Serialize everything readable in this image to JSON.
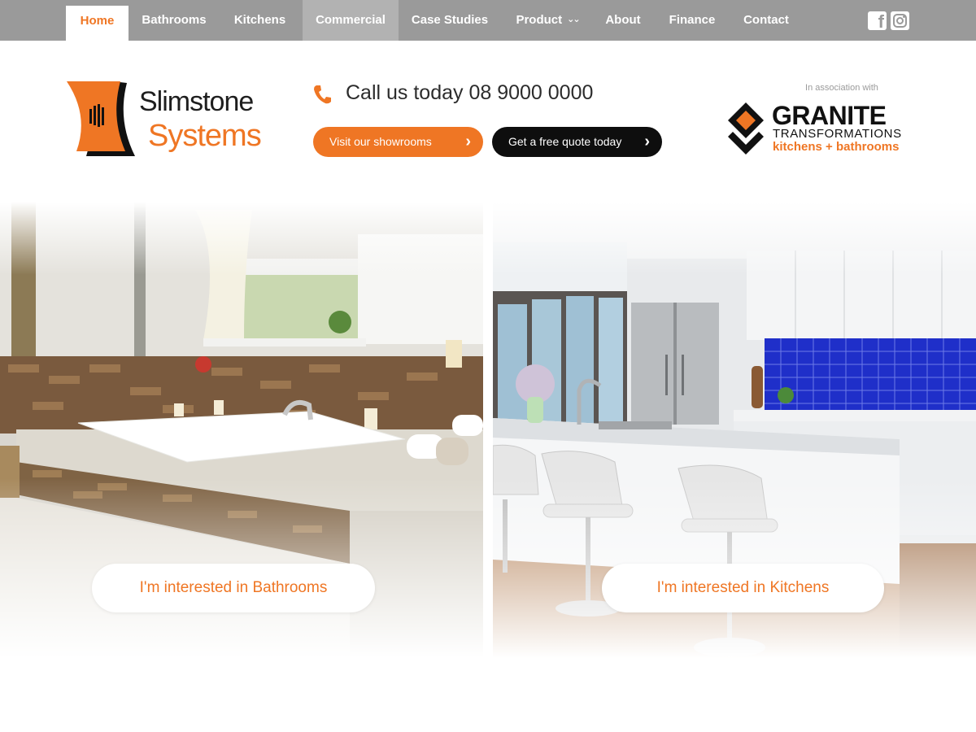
{
  "nav": {
    "items": [
      {
        "label": "Home",
        "active": true
      },
      {
        "label": "Bathrooms"
      },
      {
        "label": "Kitchens"
      },
      {
        "label": "Commercial",
        "highlighted": true
      },
      {
        "label": "Case Studies"
      },
      {
        "label": "Product",
        "has_dropdown": true
      },
      {
        "label": "About"
      },
      {
        "label": "Finance"
      },
      {
        "label": "Contact"
      }
    ],
    "social": [
      "facebook-icon",
      "instagram-icon"
    ]
  },
  "header": {
    "logo": {
      "line1": "Slimstone",
      "line2": "Systems"
    },
    "phone_text": "Call us today 08 9000 0000",
    "buttons": {
      "showrooms": "Visit our showrooms",
      "quote": "Get a free quote today"
    },
    "association": {
      "caption": "In association with",
      "brand": "GRANITE",
      "sub": "TRANSFORMATIONS",
      "tagline": "kitchens + bathrooms"
    }
  },
  "hero": {
    "bathrooms_cta": "I'm interested in Bathrooms",
    "kitchens_cta": "I'm interested in Kitchens"
  },
  "colors": {
    "accent": "#ef7624",
    "nav_bg": "#9a9a9a",
    "nav_highlight": "#b2b2b2",
    "dark_button": "#0e0e0e",
    "backsplash_blue": "#1f2fc9"
  }
}
